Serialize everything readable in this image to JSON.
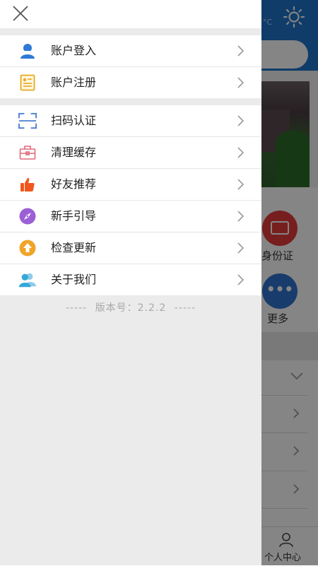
{
  "background": {
    "temperature_fragment": "°C",
    "id_label": "身份证",
    "more_label": "更多",
    "tab_label": "个人中心"
  },
  "drawer": {
    "group1": [
      {
        "label": "账户登入",
        "icon": "user-icon",
        "color": "#2f7ad6"
      },
      {
        "label": "账户注册",
        "icon": "register-form-icon",
        "color": "#e8a91e"
      }
    ],
    "group2": [
      {
        "label": "扫码认证",
        "icon": "scan-icon",
        "color": "#4a7fd1"
      },
      {
        "label": "清理缓存",
        "icon": "briefcase-icon",
        "color": "#e06a7a"
      },
      {
        "label": "好友推荐",
        "icon": "thumbs-up-icon",
        "color": "#f0571c"
      },
      {
        "label": "新手引导",
        "icon": "compass-icon",
        "color": "#9b5fd6"
      },
      {
        "label": "检查更新",
        "icon": "upload-arrow-icon",
        "color": "#f0a52a"
      },
      {
        "label": "关于我们",
        "icon": "people-icon",
        "color": "#35a7d8"
      }
    ],
    "version_dashes_left": "-----",
    "version_text": "版本号：2.2.2",
    "version_dashes_right": "-----"
  }
}
